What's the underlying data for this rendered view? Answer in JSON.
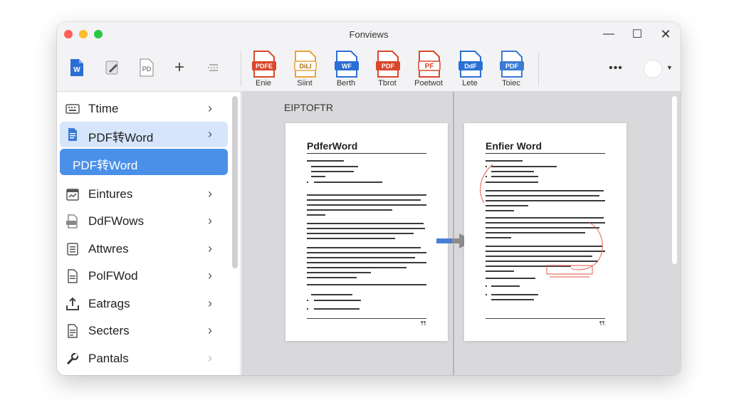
{
  "window": {
    "title": "Fonviews"
  },
  "window_controls": {
    "minimize": "—",
    "maximize": "☐",
    "close": "✕"
  },
  "toolbar": {
    "small_tools": [
      {
        "icon": "word-icon"
      },
      {
        "icon": "edit-icon"
      },
      {
        "icon": "pdf-doc-icon"
      },
      {
        "icon": "plus-icon",
        "glyph": "+"
      },
      {
        "icon": "split-icon"
      }
    ],
    "file_tools": [
      {
        "label": "Enie",
        "badge": "PDFE",
        "color": "#d9472b"
      },
      {
        "label": "Siint",
        "badge": "DiLI",
        "color": "#e9a43a"
      },
      {
        "label": "Berth",
        "badge": "WF",
        "color": "#2b6fd4"
      },
      {
        "label": "Tbrot",
        "badge": "PDF",
        "color": "#d9472b"
      },
      {
        "label": "Poetwot",
        "badge": "PF",
        "color": "#d9472b"
      },
      {
        "label": "Lete",
        "badge": "DdF",
        "color": "#2b6fd4"
      },
      {
        "label": "Toiec",
        "badge": "PDF",
        "color": "#3a7bd5"
      }
    ],
    "more_label": "•••"
  },
  "sidebar": {
    "items": [
      {
        "label": "Ttime",
        "icon": "keyboard-icon"
      },
      {
        "label": "PDF转Word",
        "icon": "document-icon",
        "selected": true
      },
      {
        "label": "Eintures",
        "icon": "calendar-icon"
      },
      {
        "label": "DdFWows",
        "icon": "pdf-icon"
      },
      {
        "label": "Attwres",
        "icon": "list-icon"
      },
      {
        "label": "PolFWod",
        "icon": "file-icon"
      },
      {
        "label": "Eatrags",
        "icon": "upload-icon"
      },
      {
        "label": "Secters",
        "icon": "notes-icon"
      },
      {
        "label": "Pantals",
        "icon": "tool-icon"
      }
    ],
    "active_item": {
      "label": "PDF转Word"
    }
  },
  "content": {
    "section_heading": "EIPTOFTR",
    "source_doc": {
      "title": "PdferWord"
    },
    "output_doc": {
      "title": "Enfier Word"
    },
    "page_number": "¶¶"
  },
  "colors": {
    "accent": "#4a90e8",
    "selected_bg": "#d6e5fb",
    "arrow": "#4a7fd8",
    "markup_red": "#e8604c"
  }
}
